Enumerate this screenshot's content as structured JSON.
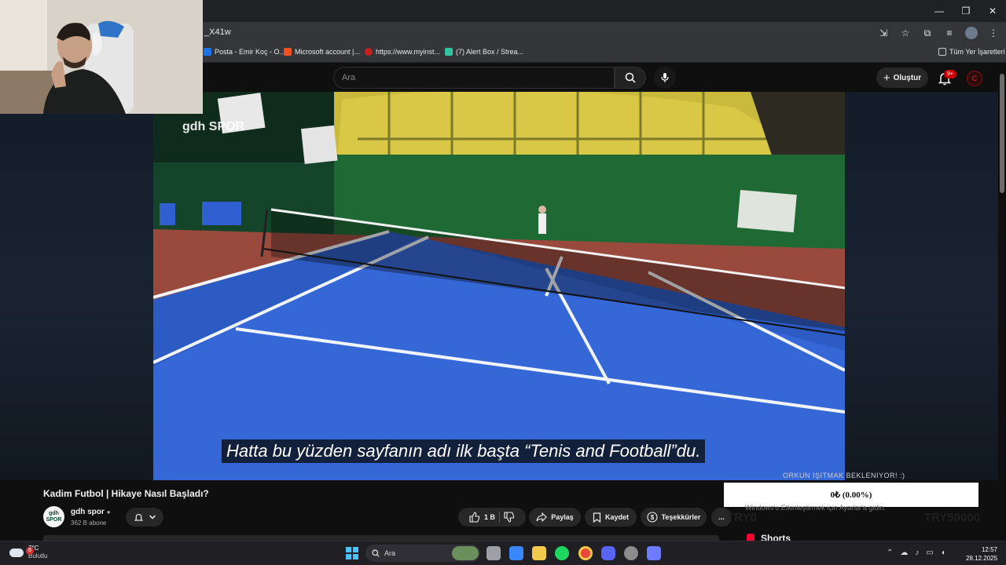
{
  "browser": {
    "url_fragment": "_X41w",
    "bookmarks": [
      {
        "label": "Posta - Emir Koç - O...",
        "color": "#1a73e8"
      },
      {
        "label": "Microsoft account |...",
        "color": "#f25022"
      },
      {
        "label": "https://www.myinst...",
        "color": "#c5221f"
      },
      {
        "label": "(7) Alert Box / Strea...",
        "color": "#31c3a2"
      }
    ],
    "all_bookmarks_label": "Tüm Yer İşaretleri"
  },
  "youtube": {
    "search_placeholder": "Ara",
    "create_label": "Oluştur",
    "notif_badge": "9+",
    "channel_avatar_letter": "C"
  },
  "video": {
    "watermark": "gdh SPOR",
    "subtitle": "Hatta bu yüzden sayfanın adı ilk başta “Tenis and Football”du."
  },
  "info": {
    "title": "Kadim Futbol | Hikaye Nasıl Başladı?",
    "channel_name": "gdh spor",
    "channel_logo_line1": "gdh",
    "channel_logo_line2": "SPOR",
    "subscribers": "362 B abone",
    "like_count": "1 B",
    "share_label": "Paylaş",
    "save_label": "Kaydet",
    "thanks_label": "Teşekkürler",
    "more_label": "..."
  },
  "overlay": {
    "donate_heading": "ORKUN IŞITMAK BEKLENIYOR! :)",
    "donate_value": "0₺ (0.00%)",
    "ghost_text": "Windows'u Etkinleştirmek için Ayarlar'a gidin.",
    "ghost_left": "TRY0",
    "ghost_right": "TRY50000",
    "shorts_label": "Shorts"
  },
  "taskbar": {
    "weather_temp": "7°C",
    "weather_desc": "Bulutlu",
    "weather_badge": "6",
    "search_label": "Ara",
    "time": "12:57",
    "date": "28.12.2025",
    "apps": [
      {
        "name": "task-view",
        "color": "#9e9ea7"
      },
      {
        "name": "app-store",
        "color": "#3a86ff"
      },
      {
        "name": "file-explorer",
        "color": "#f2c94c"
      },
      {
        "name": "spotify",
        "color": "#1ed760"
      },
      {
        "name": "chrome",
        "color": "#e8453c"
      },
      {
        "name": "discord",
        "color": "#5865f2"
      },
      {
        "name": "obs",
        "color": "#8c8c8c"
      },
      {
        "name": "dev-app",
        "color": "#6c7bff"
      }
    ]
  }
}
